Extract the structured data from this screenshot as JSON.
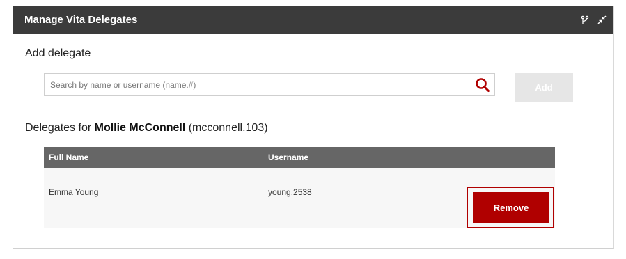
{
  "header": {
    "title": "Manage Vita Delegates",
    "icons": [
      "branch-icon",
      "collapse-icon"
    ]
  },
  "add_section": {
    "title": "Add delegate",
    "search_placeholder": "Search by name or username (name.#)",
    "search_value": "",
    "add_label": "Add"
  },
  "delegates_section": {
    "prefix": "Delegates for ",
    "owner_name": "Mollie McConnell",
    "owner_username": " (mcconnell.103)"
  },
  "table": {
    "columns": [
      "Full Name",
      "Username"
    ],
    "rows": [
      {
        "full_name": "Emma Young",
        "username": "young.2538",
        "action": "Remove"
      }
    ]
  },
  "colors": {
    "header_bg": "#3b3b3b",
    "table_head_bg": "#666666",
    "accent_red": "#b00000",
    "disabled_btn": "#e6e6e6"
  }
}
